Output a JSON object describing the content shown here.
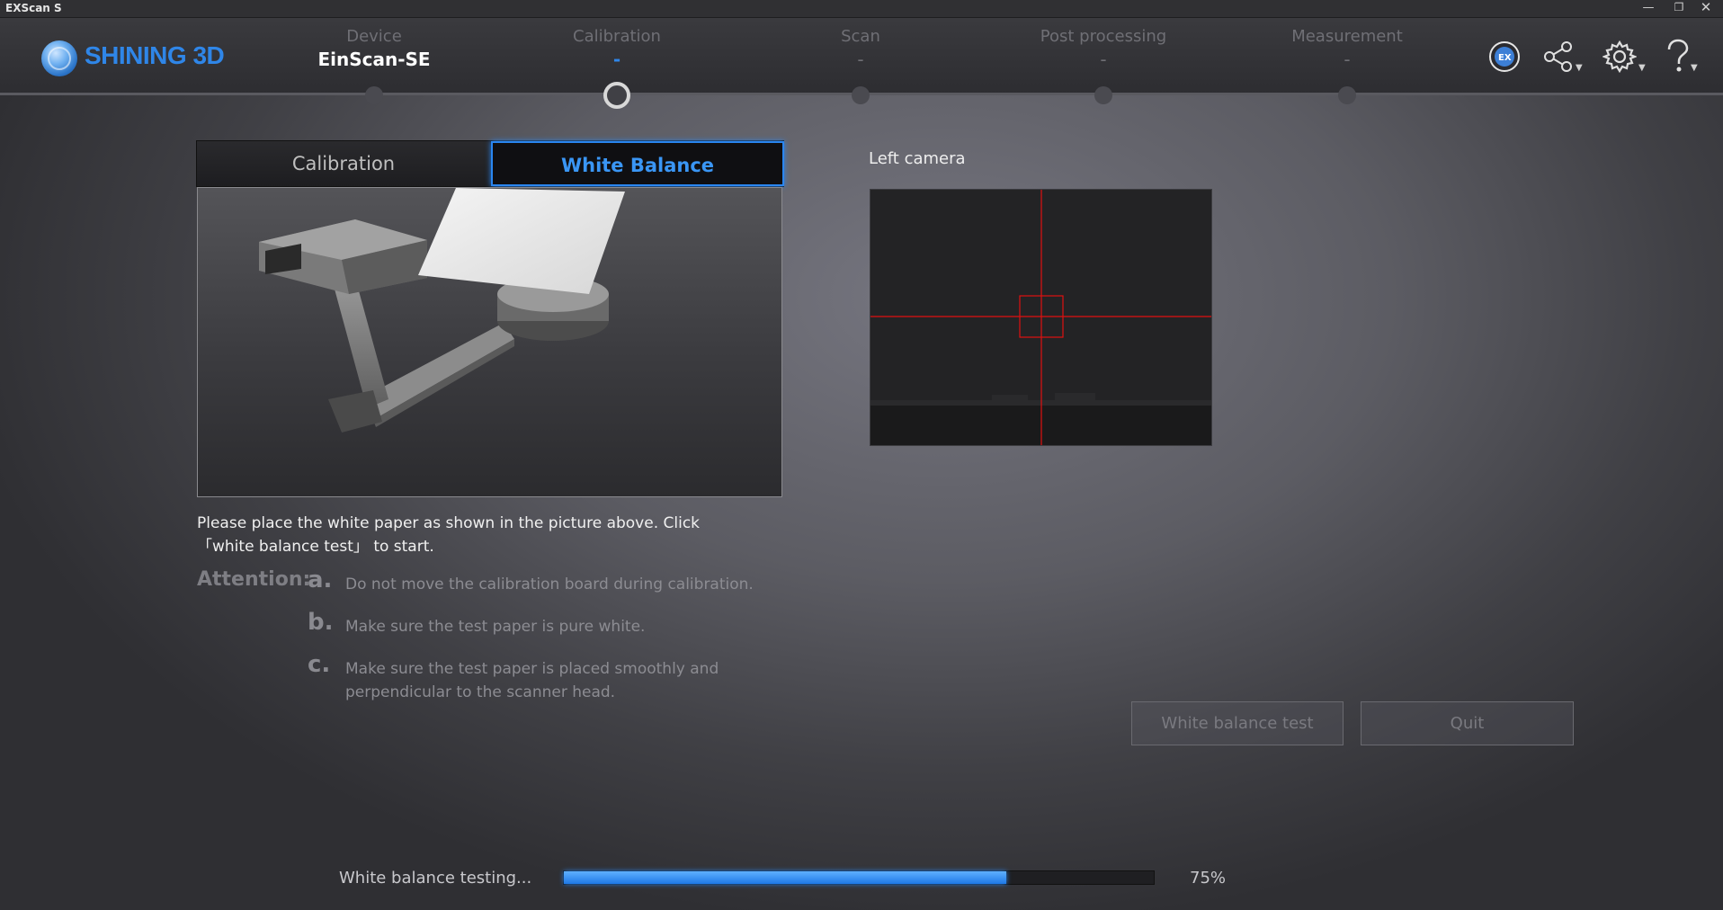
{
  "window": {
    "title": "EXScan S"
  },
  "brand": {
    "name": "SHINING 3D"
  },
  "steps": [
    {
      "label": "Device",
      "value": "EinScan-SE",
      "state": "done"
    },
    {
      "label": "Calibration",
      "value": "-",
      "state": "current"
    },
    {
      "label": "Scan",
      "value": "-",
      "state": "pending"
    },
    {
      "label": "Post processing",
      "value": "-",
      "state": "pending"
    },
    {
      "label": "Measurement",
      "value": "-",
      "state": "pending"
    }
  ],
  "header_icons": [
    "ex-model-icon",
    "share-icon",
    "gear-icon",
    "help-icon"
  ],
  "tabs": {
    "calibration": "Calibration",
    "white_balance": "White Balance",
    "active": "white_balance"
  },
  "instruction": {
    "line1": "Please place the white paper as shown in the picture above. Click",
    "line2": "「white balance test」 to start."
  },
  "attention": {
    "title": "Attention:",
    "items": [
      {
        "letter": "a.",
        "text": "Do not move the calibration board during calibration."
      },
      {
        "letter": "b.",
        "text": "Make sure the test paper is pure white."
      },
      {
        "letter": "c.",
        "text": "Make sure the test paper is placed smoothly and perpendicular to the scanner head."
      }
    ]
  },
  "camera": {
    "label": "Left camera"
  },
  "buttons": {
    "white_balance_test": "White balance test",
    "quit": "Quit"
  },
  "progress": {
    "label": "White balance testing...",
    "percent_text": "75%",
    "value": 0.75
  },
  "colors": {
    "accent": "#2f86e8",
    "crosshair": "#e01010"
  }
}
